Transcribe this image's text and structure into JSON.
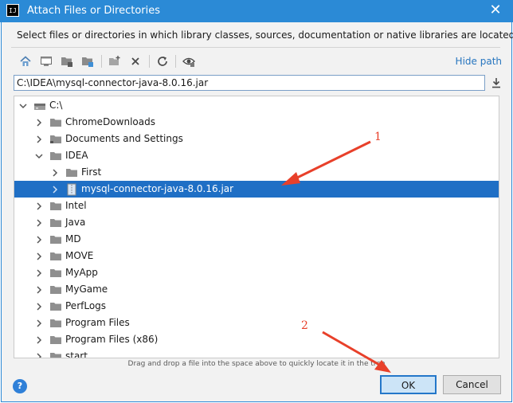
{
  "window": {
    "title": "Attach Files or Directories",
    "app_icon_text": "IJ",
    "close_glyph": "✕"
  },
  "description": "Select files or directories in which library classes, sources, documentation or native libraries are located",
  "toolbar": {
    "buttons": [
      "home-icon",
      "desktop-icon",
      "project-icon",
      "module-icon",
      "new-folder-icon",
      "delete-icon",
      "refresh-icon",
      "show-hidden-icon"
    ],
    "hide_path_label": "Hide path"
  },
  "path": {
    "value": "C:\\IDEA\\mysql-connector-java-8.0.16.jar"
  },
  "tree": {
    "rows": [
      {
        "label": "C:\\",
        "depth": 0,
        "expanded": true,
        "icon": "drive-icon",
        "selected": false
      },
      {
        "label": "ChromeDownloads",
        "depth": 1,
        "expanded": false,
        "icon": "folder-icon",
        "selected": false
      },
      {
        "label": "Documents and Settings",
        "depth": 1,
        "expanded": false,
        "icon": "folder-link-icon",
        "selected": false
      },
      {
        "label": "IDEA",
        "depth": 1,
        "expanded": true,
        "icon": "folder-icon",
        "selected": false
      },
      {
        "label": "First",
        "depth": 2,
        "expanded": false,
        "icon": "folder-icon",
        "selected": false
      },
      {
        "label": "mysql-connector-java-8.0.16.jar",
        "depth": 2,
        "expanded": false,
        "icon": "jar-icon",
        "selected": true
      },
      {
        "label": "Intel",
        "depth": 1,
        "expanded": false,
        "icon": "folder-icon",
        "selected": false
      },
      {
        "label": "Java",
        "depth": 1,
        "expanded": false,
        "icon": "folder-icon",
        "selected": false
      },
      {
        "label": "MD",
        "depth": 1,
        "expanded": false,
        "icon": "folder-icon",
        "selected": false
      },
      {
        "label": "MOVE",
        "depth": 1,
        "expanded": false,
        "icon": "folder-icon",
        "selected": false
      },
      {
        "label": "MyApp",
        "depth": 1,
        "expanded": false,
        "icon": "folder-icon",
        "selected": false
      },
      {
        "label": "MyGame",
        "depth": 1,
        "expanded": false,
        "icon": "folder-icon",
        "selected": false
      },
      {
        "label": "PerfLogs",
        "depth": 1,
        "expanded": false,
        "icon": "folder-icon",
        "selected": false
      },
      {
        "label": "Program Files",
        "depth": 1,
        "expanded": false,
        "icon": "folder-icon",
        "selected": false
      },
      {
        "label": "Program Files (x86)",
        "depth": 1,
        "expanded": false,
        "icon": "folder-icon",
        "selected": false
      },
      {
        "label": "start",
        "depth": 1,
        "expanded": false,
        "icon": "folder-icon",
        "selected": false
      }
    ]
  },
  "hint": "Drag and drop a file into the space above to quickly locate it in the tree",
  "footer": {
    "help_glyph": "?",
    "ok_label": "OK",
    "cancel_label": "Cancel"
  },
  "annotations": {
    "label_1": "1",
    "label_2": "2",
    "color": "#e8402a"
  },
  "colors": {
    "titlebar": "#2b8ad6",
    "selection": "#1f6fc5",
    "link": "#2675bf"
  }
}
